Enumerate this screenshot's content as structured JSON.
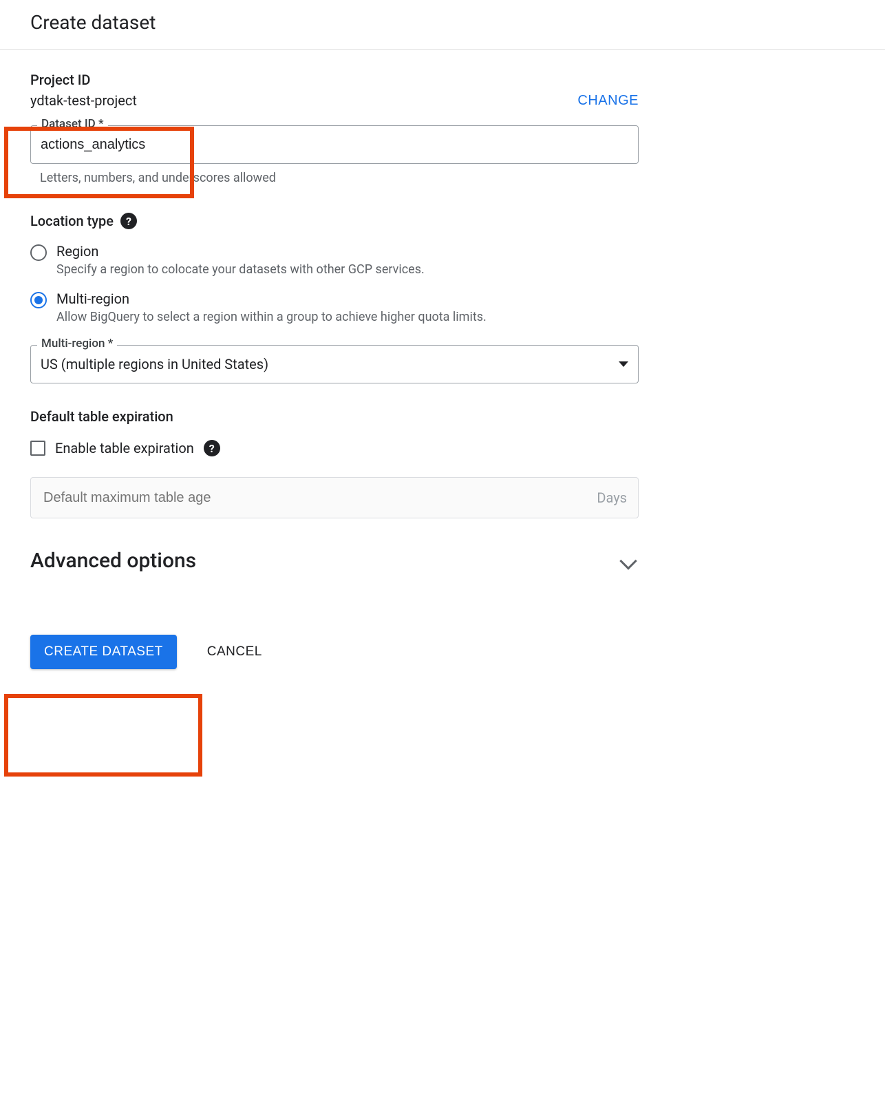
{
  "title": "Create dataset",
  "project": {
    "label": "Project ID",
    "value": "ydtak-test-project",
    "change_label": "CHANGE"
  },
  "dataset_id": {
    "label": "Dataset ID *",
    "value": "actions_analytics",
    "helper": "Letters, numbers, and underscores allowed"
  },
  "location_type": {
    "label": "Location type",
    "options": [
      {
        "title": "Region",
        "desc": "Specify a region to colocate your datasets with other GCP services.",
        "selected": false
      },
      {
        "title": "Multi-region",
        "desc": "Allow BigQuery to select a region within a group to achieve higher quota limits.",
        "selected": true
      }
    ]
  },
  "multi_region": {
    "label": "Multi-region *",
    "value": "US (multiple regions in United States)"
  },
  "expiration": {
    "label": "Default table expiration",
    "checkbox_label": "Enable table expiration",
    "checked": false,
    "max_age_placeholder": "Default maximum table age",
    "unit": "Days"
  },
  "advanced": {
    "label": "Advanced options"
  },
  "actions": {
    "create": "CREATE DATASET",
    "cancel": "CANCEL"
  }
}
